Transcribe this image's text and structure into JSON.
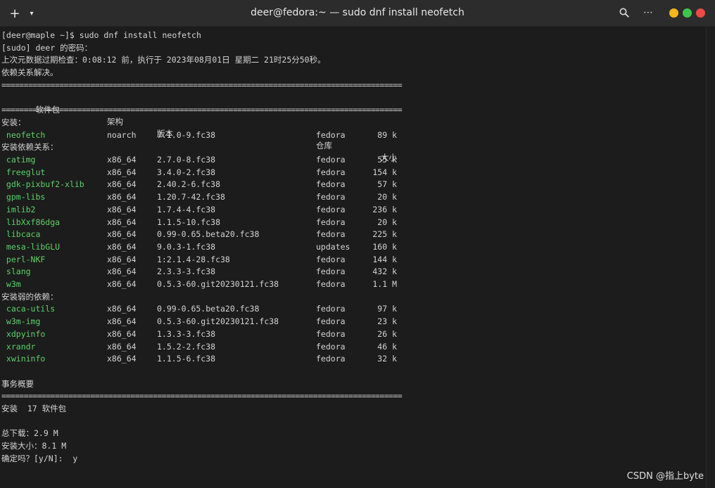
{
  "window": {
    "title": "deer@fedora:~ — sudo dnf install neofetch",
    "new_tab_glyph": "+",
    "menu_glyph": "▾",
    "search_glyph": "⌕",
    "more_glyph": "⋯",
    "controls": {
      "minimize_color": "#f6b51e",
      "maximize_color": "#3dc74a",
      "close_color": "#ec4a44"
    }
  },
  "terminal": {
    "prompt_line": "[deer@maple ~]$ sudo dnf install neofetch",
    "sudo_prompt": "[sudo] deer 的密码：",
    "metadata_check": "上次元数据过期检查：0:08:12 前，执行于 2023年08月01日 星期二 21时25分50秒。",
    "deps_resolved": "依赖关系解决。",
    "rule": "==========================================================================================",
    "headers": {
      "package": " 软件包",
      "arch": "架构",
      "version": "版本",
      "repo": "仓库",
      "size": "大小"
    },
    "install_section": "安装：",
    "install_pkgs": [
      {
        "name": "neofetch",
        "arch": "noarch",
        "version": "7.1.0-9.fc38",
        "repo": "fedora",
        "size": "89 k"
      }
    ],
    "deps_section": "安装依赖关系：",
    "dep_pkgs": [
      {
        "name": "catimg",
        "arch": "x86_64",
        "version": "2.7.0-8.fc38",
        "repo": "fedora",
        "size": "55 k"
      },
      {
        "name": "freeglut",
        "arch": "x86_64",
        "version": "3.4.0-2.fc38",
        "repo": "fedora",
        "size": "154 k"
      },
      {
        "name": "gdk-pixbuf2-xlib",
        "arch": "x86_64",
        "version": "2.40.2-6.fc38",
        "repo": "fedora",
        "size": "57 k"
      },
      {
        "name": "gpm-libs",
        "arch": "x86_64",
        "version": "1.20.7-42.fc38",
        "repo": "fedora",
        "size": "20 k"
      },
      {
        "name": "imlib2",
        "arch": "x86_64",
        "version": "1.7.4-4.fc38",
        "repo": "fedora",
        "size": "236 k"
      },
      {
        "name": "libXxf86dga",
        "arch": "x86_64",
        "version": "1.1.5-10.fc38",
        "repo": "fedora",
        "size": "20 k"
      },
      {
        "name": "libcaca",
        "arch": "x86_64",
        "version": "0.99-0.65.beta20.fc38",
        "repo": "fedora",
        "size": "225 k"
      },
      {
        "name": "mesa-libGLU",
        "arch": "x86_64",
        "version": "9.0.3-1.fc38",
        "repo": "updates",
        "size": "160 k"
      },
      {
        "name": "perl-NKF",
        "arch": "x86_64",
        "version": "1:2.1.4-28.fc38",
        "repo": "fedora",
        "size": "144 k"
      },
      {
        "name": "slang",
        "arch": "x86_64",
        "version": "2.3.3-3.fc38",
        "repo": "fedora",
        "size": "432 k"
      },
      {
        "name": "w3m",
        "arch": "x86_64",
        "version": "0.5.3-60.git20230121.fc38",
        "repo": "fedora",
        "size": "1.1 M"
      }
    ],
    "weak_section": "安装弱的依赖：",
    "weak_pkgs": [
      {
        "name": "caca-utils",
        "arch": "x86_64",
        "version": "0.99-0.65.beta20.fc38",
        "repo": "fedora",
        "size": "97 k"
      },
      {
        "name": "w3m-img",
        "arch": "x86_64",
        "version": "0.5.3-60.git20230121.fc38",
        "repo": "fedora",
        "size": "23 k"
      },
      {
        "name": "xdpyinfo",
        "arch": "x86_64",
        "version": "1.3.3-3.fc38",
        "repo": "fedora",
        "size": "26 k"
      },
      {
        "name": "xrandr",
        "arch": "x86_64",
        "version": "1.5.2-2.fc38",
        "repo": "fedora",
        "size": "46 k"
      },
      {
        "name": "xwininfo",
        "arch": "x86_64",
        "version": "1.1.5-6.fc38",
        "repo": "fedora",
        "size": "32 k"
      }
    ],
    "summary_title": "事务概要",
    "summary_install": "安装  17 软件包",
    "total_download": "总下载：2.9 M",
    "install_size": "安装大小：8.1 M",
    "confirm": "确定吗？[y/N]:  y"
  },
  "watermark": "CSDN @指上byte"
}
